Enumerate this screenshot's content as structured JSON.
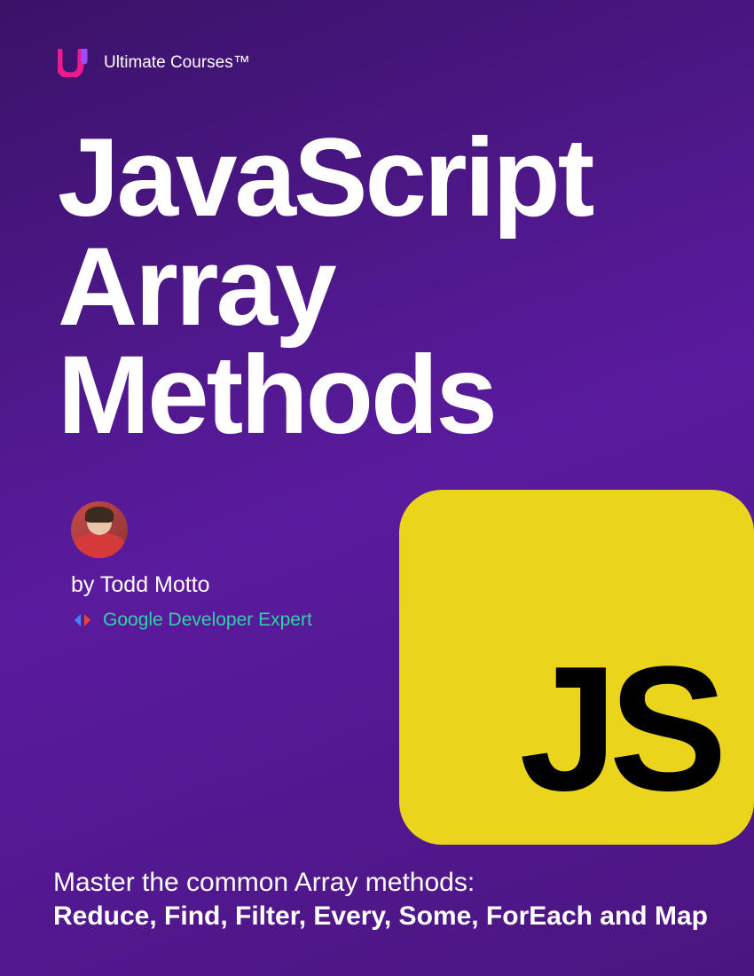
{
  "header": {
    "brand": "Ultimate Courses™"
  },
  "title": {
    "line1": "JavaScript",
    "line2": "Array",
    "line3": "Methods"
  },
  "author": {
    "byline": "by Todd Motto",
    "credential": "Google Developer Expert"
  },
  "badge": {
    "label": "JS"
  },
  "footer": {
    "line1": "Master the common Array methods:",
    "line2": "Reduce, Find, Filter, Every, Some, ForEach and Map"
  }
}
